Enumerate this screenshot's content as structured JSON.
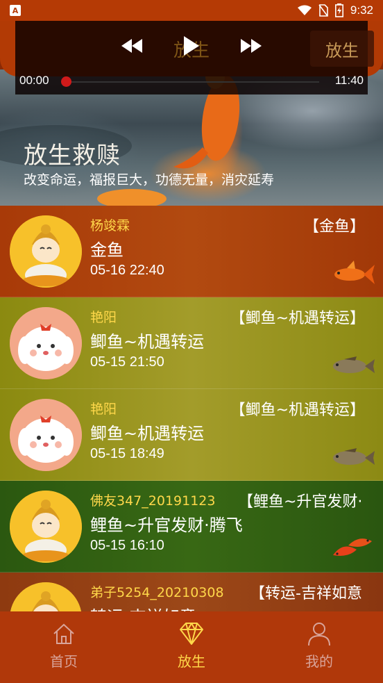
{
  "status_bar": {
    "app_badge": "A",
    "time": "9:32"
  },
  "player": {
    "ghost_text": "放生",
    "release_label": "放生",
    "current_time": "00:00",
    "total_time": "11:40",
    "progress_fraction": 0
  },
  "banner": {
    "title": "放生救赎",
    "subtitle": "改变命运，福报巨大，功德无量，消灾延寿"
  },
  "records": [
    {
      "user": "杨竣霖",
      "tag": "【金鱼】",
      "name": "金鱼",
      "time": "05-16 22:40",
      "avatar": "buddha",
      "fish": "goldfish",
      "color": "orange"
    },
    {
      "user": "艳阳",
      "tag": "【鲫鱼~机遇转运】",
      "name": "鲫鱼~机遇转运",
      "time": "05-15 21:50",
      "avatar": "bunny",
      "fish": "crucian",
      "color": "olive"
    },
    {
      "user": "艳阳",
      "tag": "【鲫鱼~机遇转运】",
      "name": "鲫鱼~机遇转运",
      "time": "05-15 18:49",
      "avatar": "bunny",
      "fish": "crucian",
      "color": "olive"
    },
    {
      "user": "佛友347_20191123",
      "tag": "【鲤鱼~升官发财·",
      "name": "鲤鱼~升官发财·腾飞",
      "time": "05-15 16:10",
      "avatar": "buddha",
      "fish": "carp",
      "color": "green"
    },
    {
      "user": "弟子5254_20210308",
      "tag": "【转运-吉祥如意",
      "name": "转运-吉祥如意",
      "time": "",
      "avatar": "buddha",
      "fish": "",
      "color": "brown"
    }
  ],
  "nav": {
    "home": "首页",
    "release": "放生",
    "mine": "我的",
    "active_color": "#ffd84a",
    "inactive_color": "#d9a49a"
  }
}
